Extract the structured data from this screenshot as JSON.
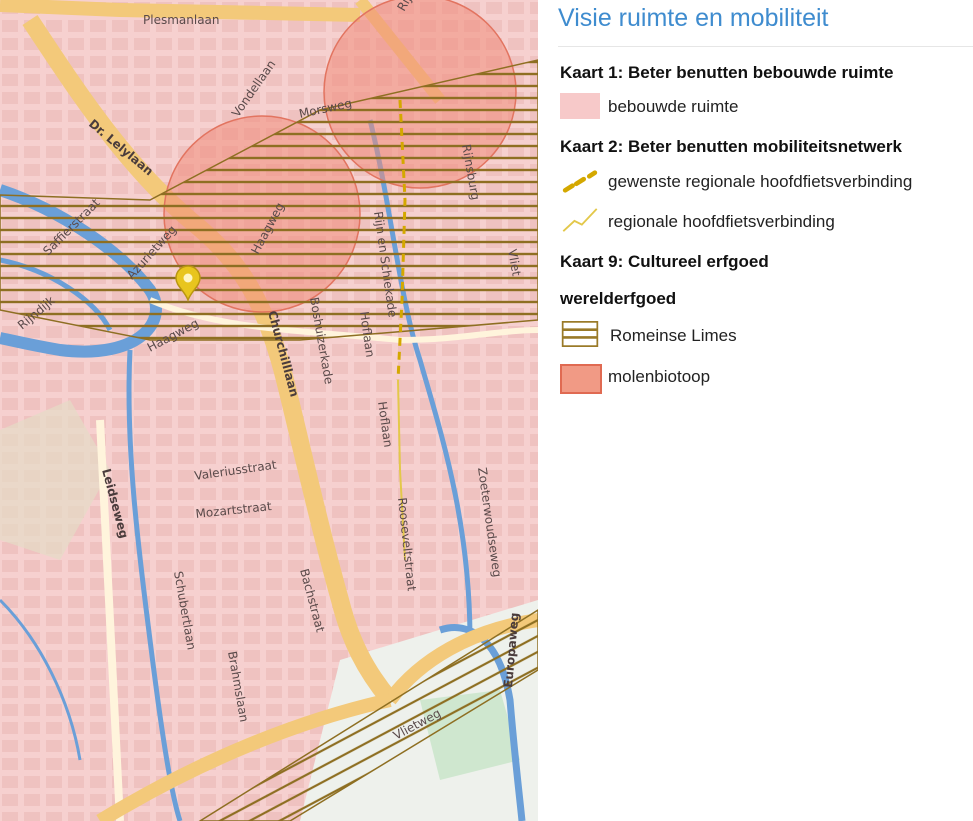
{
  "panel": {
    "title": "Visie ruimte en mobiliteit",
    "kaart1": {
      "heading": "Kaart 1: Beter benutten bebouwde ruimte",
      "items": [
        {
          "label": "bebouwde ruimte",
          "color": "#f7c9c9"
        }
      ]
    },
    "kaart2": {
      "heading": "Kaart 2: Beter benutten mobiliteitsnetwerk",
      "items": [
        {
          "label": "gewenste regionale hoofdfietsverbinding",
          "color": "#d4a800"
        },
        {
          "label": "regionale hoofdfietsverbinding",
          "color": "#e3c84a"
        }
      ]
    },
    "kaart9": {
      "heading": "Kaart 9: Cultureel erfgoed",
      "subheading": "werelderfgoed",
      "items": [
        {
          "label": "Romeinse Limes",
          "color": "#9a7a28"
        },
        {
          "label": "molenbiotoop",
          "color": "#f19a85"
        }
      ]
    }
  },
  "map": {
    "streets": [
      "Plesmanlaan",
      "Vondellaan",
      "Dr. Lelylaan",
      "Morsweg",
      "Rijnsburg",
      "Saffierstraat",
      "Azurietweg",
      "Haagweg",
      "Haagweg",
      "Rijndijk",
      "Churchilllaan",
      "Boshuizerkade",
      "Hoflaan",
      "Hoflaan",
      "Rijn en Schiekade",
      "Valeriusstraat",
      "Mozartstraat",
      "Leidseweg",
      "Schubertlaan",
      "Brahmslaan",
      "Bachstraat",
      "Rooseveltstraat",
      "Zoeterwoudseweg",
      "Vlietweg",
      "Europaweg",
      "Vliet",
      "Rijnbeg"
    ],
    "marker_icon": "map-pin-icon",
    "colors": {
      "built": "#f6d0cf",
      "water": "#6a9fd8",
      "mainroad": "#f3c97a",
      "limes": "#8e6f22",
      "molen": "#f08c7a"
    }
  }
}
